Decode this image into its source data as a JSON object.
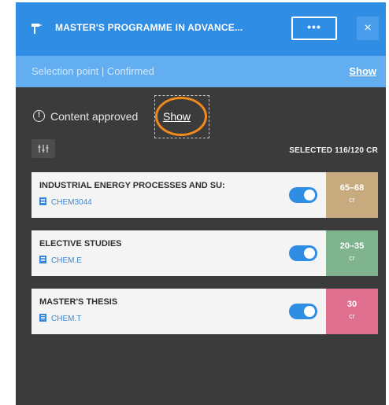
{
  "header": {
    "title": "MASTER'S PROGRAMME IN ADVANCE...",
    "more_label": "•••",
    "close_label": "×"
  },
  "subbar": {
    "status": "Selection point | Confirmed",
    "show_label": "Show"
  },
  "approval": {
    "text": "Content approved",
    "show_label": "Show"
  },
  "selected_credits": "SELECTED 116/120 CR",
  "modules": [
    {
      "name": "INDUSTRIAL ENERGY PROCESSES AND SU:",
      "code": "CHEM3044",
      "credits": "65–68",
      "unit": "cr",
      "enabled": true,
      "color": "#c7aa7e"
    },
    {
      "name": "ELECTIVE STUDIES",
      "code": "CHEM.E",
      "credits": "20–35",
      "unit": "cr",
      "enabled": true,
      "color": "#7fb48f"
    },
    {
      "name": "MASTER'S THESIS",
      "code": "CHEM.T",
      "credits": "30",
      "unit": "cr",
      "enabled": true,
      "color": "#e0708f"
    }
  ],
  "colors": {
    "header": "#2f8de4",
    "subbar": "#62aef0",
    "panel_bg": "#3b3b3b",
    "highlight": "#f08a1c"
  },
  "icons": [
    "pin-icon",
    "more-icon",
    "close-icon",
    "info-icon",
    "filter-icon",
    "code-icon"
  ]
}
